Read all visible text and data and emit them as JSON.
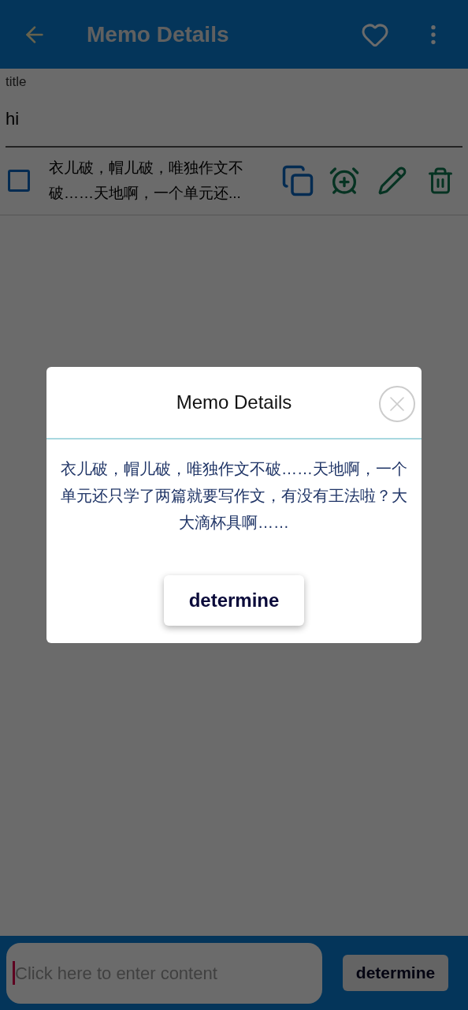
{
  "app_bar": {
    "title": "Memo Details"
  },
  "title_field": {
    "label": "title",
    "value": "hi"
  },
  "memos": [
    {
      "checked": false,
      "text": "衣儿破，帽儿破，唯独作文不破……天地啊，一个单元还..."
    }
  ],
  "dialog": {
    "title": "Memo Details",
    "body": "衣儿破，帽儿破，唯独作文不破……天地啊，一个单元还只学了两篇就要写作文，有没有王法啦？大大滴杯具啊……",
    "button": "determine"
  },
  "bottom_bar": {
    "placeholder": "Click here to enter content",
    "button": "determine"
  }
}
